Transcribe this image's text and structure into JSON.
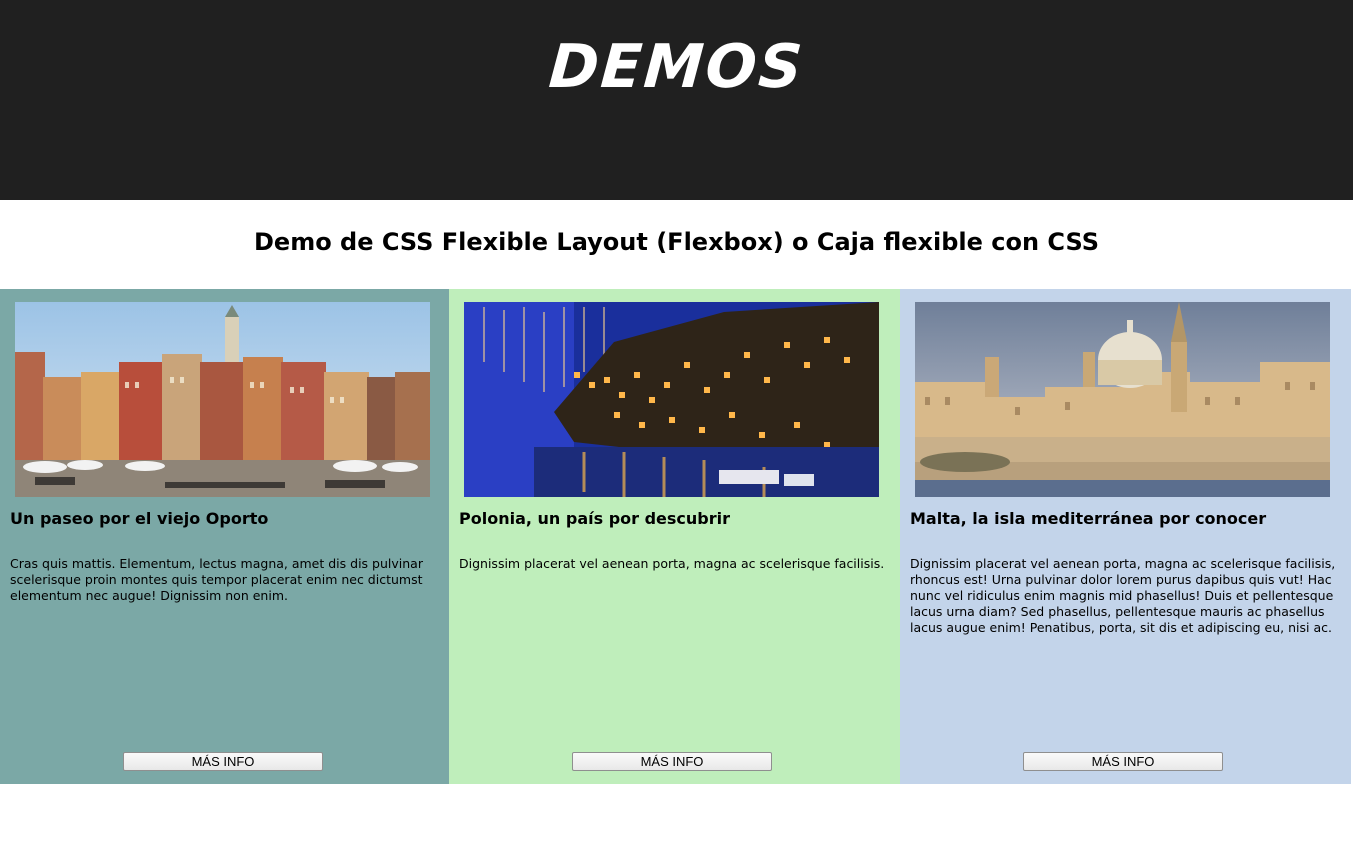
{
  "header": {
    "logo": "DEMOS",
    "background": "#202020"
  },
  "page": {
    "title": "Demo de CSS Flexible Layout (Flexbox) o Caja flexible con CSS"
  },
  "cards": [
    {
      "background": "#7ba8a6",
      "image_icon": "old-town-square-photo",
      "title": "Un paseo por el viejo Oporto",
      "text": "Cras quis mattis. Elementum, lectus magna, amet dis dis pulvinar scelerisque proin montes quis tempor placerat enim nec dictumst elementum nec augue! Dignissim non enim.",
      "button": "MÁS INFO"
    },
    {
      "background": "#bfeebb",
      "image_icon": "night-harbor-photo",
      "title": "Polonia, un país por descubrir",
      "text": "Dignissim placerat vel aenean porta, magna ac scelerisque facilisis.",
      "button": "MÁS INFO"
    },
    {
      "background": "#c3d4ea",
      "image_icon": "valletta-skyline-photo",
      "title": "Malta, la isla mediterránea por conocer",
      "text": "Dignissim placerat vel aenean porta, magna ac scelerisque facilisis, rhoncus est! Urna pulvinar dolor lorem purus dapibus quis vut! Hac nunc vel ridiculus enim magnis mid phasellus! Duis et pellentesque lacus urna diam? Sed phasellus, pellentesque mauris ac phasellus lacus augue enim! Penatibus, porta, sit dis et adipiscing eu, nisi ac.",
      "button": "MÁS INFO"
    }
  ]
}
